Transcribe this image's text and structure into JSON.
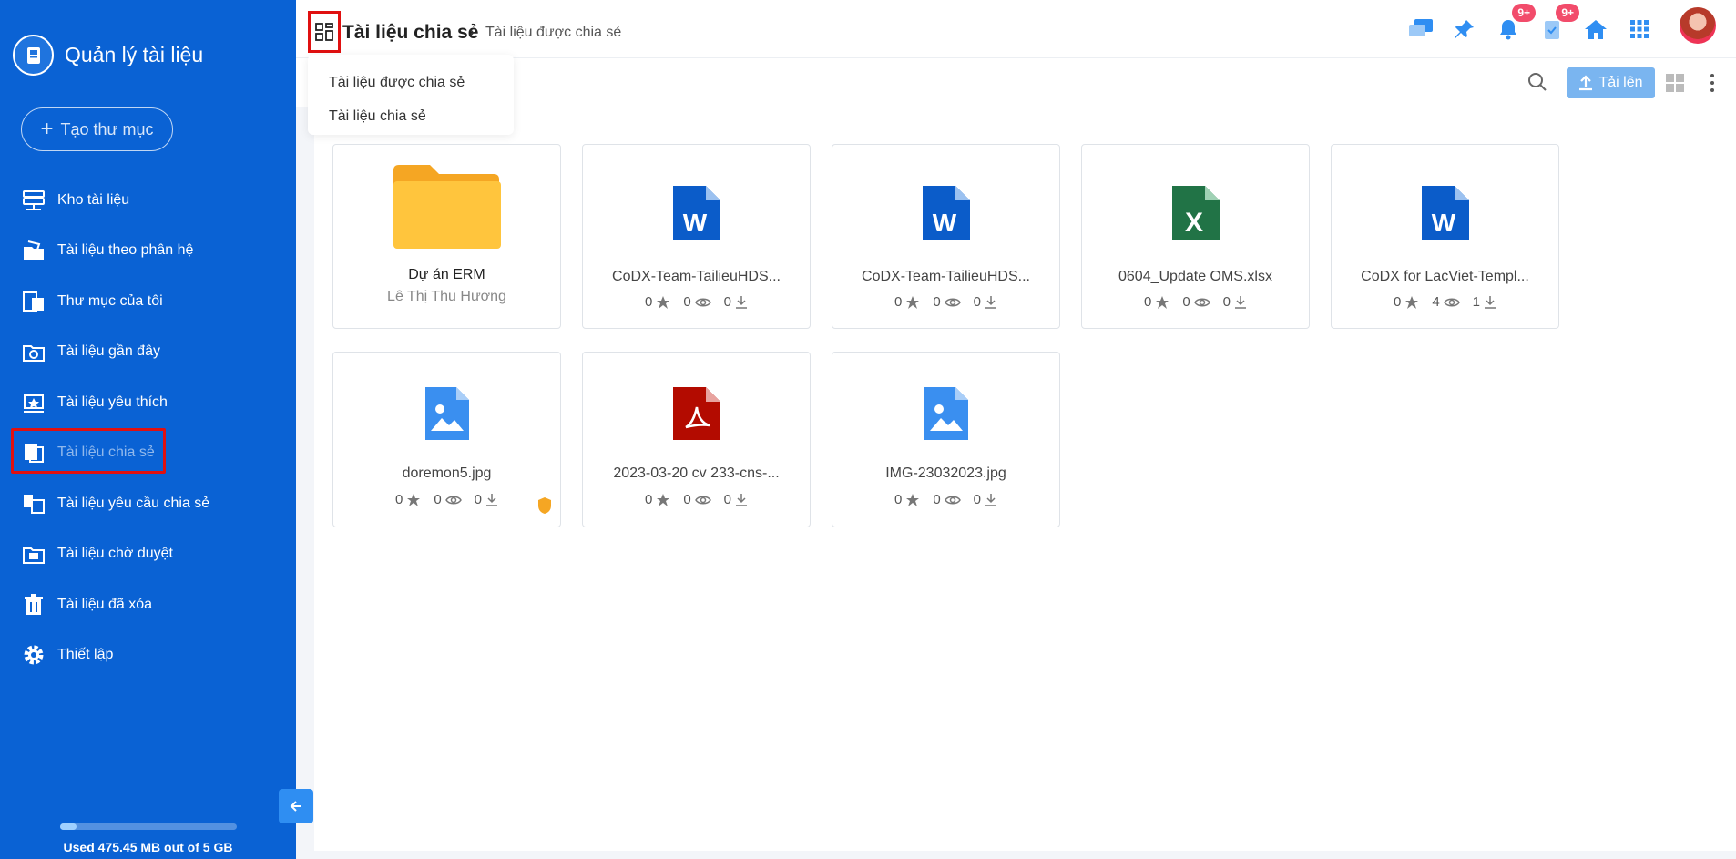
{
  "app": {
    "title": "Quản lý tài liệu",
    "new_folder": "Tạo thư mục"
  },
  "nav": [
    {
      "label": "Kho tài liệu",
      "icon": "server-icon"
    },
    {
      "label": "Tài liệu theo phân hệ",
      "icon": "module-docs-icon"
    },
    {
      "label": "Thư mục của tôi",
      "icon": "my-folder-icon"
    },
    {
      "label": "Tài liệu gần đây",
      "icon": "recent-docs-icon"
    },
    {
      "label": "Tài liệu yêu thích",
      "icon": "favorite-docs-icon"
    },
    {
      "label": "Tài liệu chia sẻ",
      "icon": "shared-docs-icon"
    },
    {
      "label": "Tài liệu yêu cầu chia sẻ",
      "icon": "share-request-icon"
    },
    {
      "label": "Tài liệu chờ duyệt",
      "icon": "pending-docs-icon"
    },
    {
      "label": "Tài liệu đã xóa",
      "icon": "trash-icon"
    },
    {
      "label": "Thiết lập",
      "icon": "gear-icon"
    }
  ],
  "storage": {
    "text": "Used 475.45 MB out of 5 GB",
    "used_fraction": 0.093
  },
  "breadcrumb": {
    "title": "Tài liệu chia sẻ",
    "sub": "Tài liệu được chia sẻ"
  },
  "dropdown": [
    "Tài liệu được chia sẻ",
    "Tài liệu chia sẻ"
  ],
  "toolbar": {
    "upload": "Tải lên"
  },
  "badges": {
    "notifications": "9+",
    "tasks": "9+"
  },
  "colors": {
    "sidebar": "#0a62d4",
    "word": "#0b5cc9",
    "excel": "#217346",
    "pdf": "#b30b00",
    "image": "#3a8ff0",
    "folder": "#ffc53d"
  },
  "cards": [
    {
      "type": "folder",
      "name": "Dự án ERM",
      "owner": "Lê Thị Thu Hương"
    },
    {
      "type": "word",
      "name": "CoDX-Team-TailieuHDS...",
      "stars": "0",
      "views": "0",
      "downloads": "0"
    },
    {
      "type": "word",
      "name": "CoDX-Team-TailieuHDS...",
      "stars": "0",
      "views": "0",
      "downloads": "0"
    },
    {
      "type": "excel",
      "name": "0604_Update OMS.xlsx",
      "stars": "0",
      "views": "0",
      "downloads": "0"
    },
    {
      "type": "word",
      "name": "CoDX for LacViet-Templ...",
      "stars": "0",
      "views": "4",
      "downloads": "1"
    },
    {
      "type": "image",
      "name": "doremon5.jpg",
      "stars": "0",
      "views": "0",
      "downloads": "0"
    },
    {
      "type": "pdf",
      "name": "2023-03-20 cv 233-cns-...",
      "stars": "0",
      "views": "0",
      "downloads": "0"
    },
    {
      "type": "image",
      "name": "IMG-23032023.jpg",
      "stars": "0",
      "views": "0",
      "downloads": "0"
    }
  ]
}
